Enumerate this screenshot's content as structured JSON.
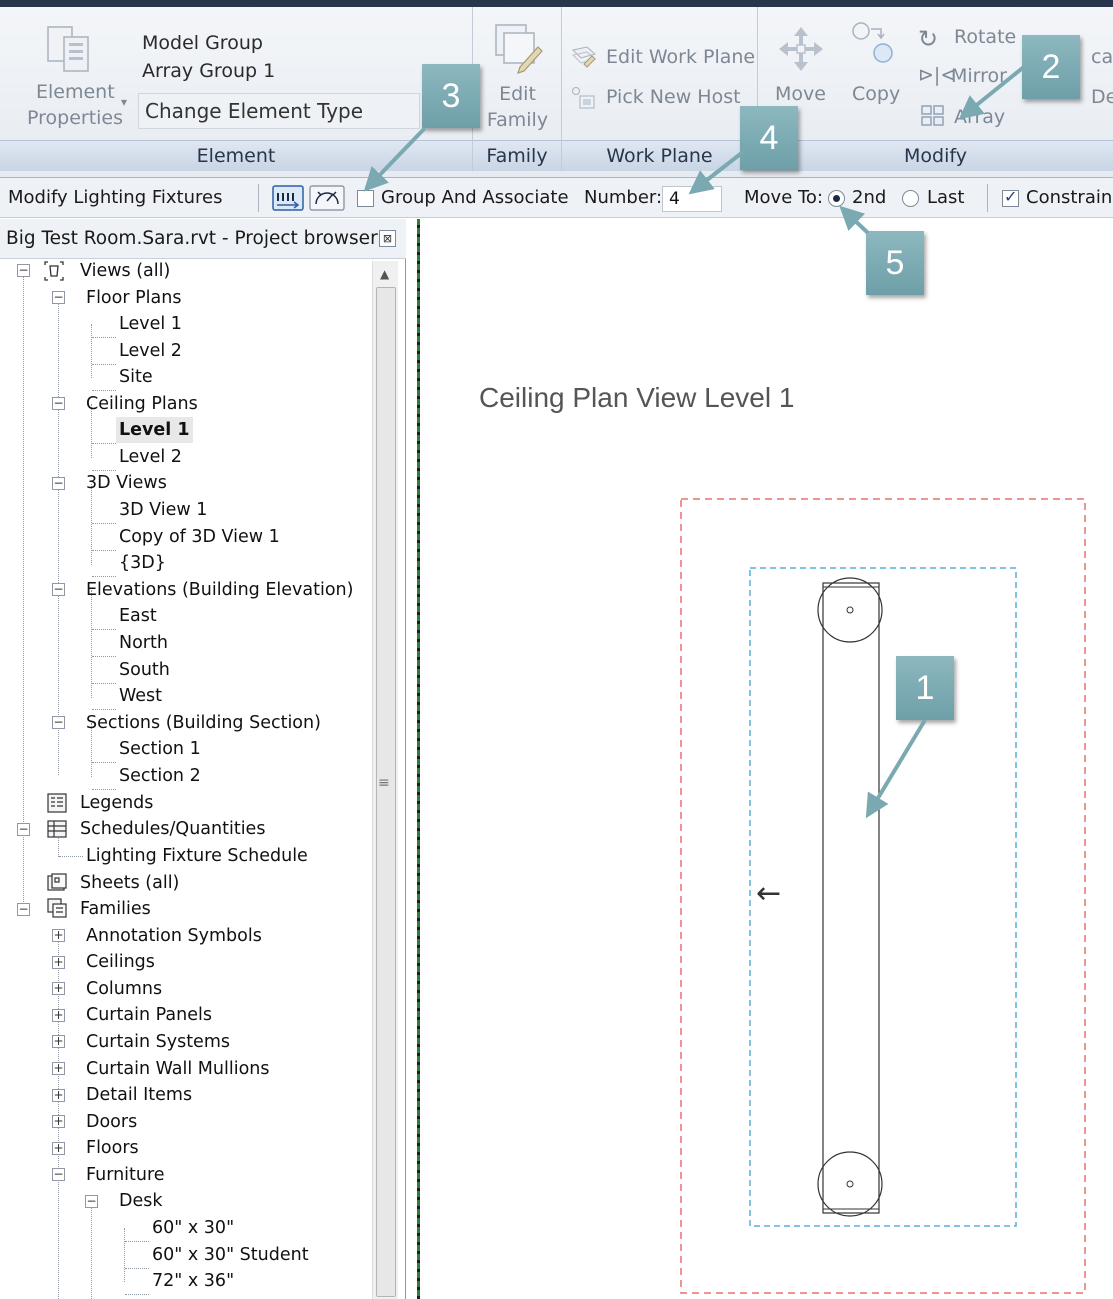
{
  "ribbon": {
    "element_panel": {
      "title": "Element",
      "properties_line1": "Element",
      "properties_line2": "Properties",
      "model_group": "Model Group",
      "array_group": "Array Group 1",
      "change_type": "Change Element Type"
    },
    "family_panel": {
      "title": "Family",
      "edit_line1": "Edit",
      "edit_line2": "Family"
    },
    "work_plane_panel": {
      "title": "Work Plane",
      "edit_work_plane": "Edit Work Plane",
      "pick_new_host": "Pick New Host"
    },
    "modify_panel": {
      "title": "Modify",
      "move": "Move",
      "copy": "Copy",
      "rotate": "Rotate",
      "mirror": "Mirror",
      "array": "Array",
      "scale_partial": "cale",
      "delete_partial": "Dele"
    }
  },
  "options_bar": {
    "context": "Modify Lighting Fixtures",
    "group_and_associate": "Group And Associate",
    "group_checked": false,
    "number_label": "Number:",
    "number_value": "4",
    "move_to_label": "Move To:",
    "move_to_2nd": "2nd",
    "move_to_last": "Last",
    "move_to_selected": "2nd",
    "constrain": "Constrain",
    "constrain_checked": true
  },
  "browser": {
    "title": "Big Test Room.Sara.rvt - Project browser",
    "close_label": "⊠",
    "items": [
      {
        "label": "Views (all)"
      },
      {
        "label": "Floor Plans"
      },
      {
        "label": "Level 1"
      },
      {
        "label": "Level 2"
      },
      {
        "label": "Site"
      },
      {
        "label": "Ceiling Plans"
      },
      {
        "label": "Level 1",
        "selected": true
      },
      {
        "label": "Level 2"
      },
      {
        "label": "3D Views"
      },
      {
        "label": "3D View 1"
      },
      {
        "label": "Copy of 3D View 1"
      },
      {
        "label": "{3D}"
      },
      {
        "label": "Elevations (Building Elevation)"
      },
      {
        "label": "East"
      },
      {
        "label": "North"
      },
      {
        "label": "South"
      },
      {
        "label": "West"
      },
      {
        "label": "Sections (Building Section)"
      },
      {
        "label": "Section 1"
      },
      {
        "label": "Section 2"
      },
      {
        "label": "Legends"
      },
      {
        "label": "Schedules/Quantities"
      },
      {
        "label": "Lighting Fixture Schedule"
      },
      {
        "label": "Sheets (all)"
      },
      {
        "label": "Families"
      },
      {
        "label": "Annotation Symbols"
      },
      {
        "label": "Ceilings"
      },
      {
        "label": "Columns"
      },
      {
        "label": "Curtain Panels"
      },
      {
        "label": "Curtain Systems"
      },
      {
        "label": "Curtain Wall Mullions"
      },
      {
        "label": "Detail Items"
      },
      {
        "label": "Doors"
      },
      {
        "label": "Floors"
      },
      {
        "label": "Furniture"
      },
      {
        "label": "Desk"
      },
      {
        "label": "60\" x 30\""
      },
      {
        "label": "60\" x 30\" Student"
      },
      {
        "label": "72\" x 36\""
      }
    ]
  },
  "canvas": {
    "view_title": "Ceiling Plan View Level 1",
    "direction_arrow": "←"
  },
  "callouts": [
    "1",
    "2",
    "3",
    "4",
    "5"
  ],
  "colors": {
    "callout": "#7aa9b1",
    "outer_dash": "#e8716f",
    "inner_dash": "#5aaed9",
    "ribbon_title": "#27364b"
  }
}
